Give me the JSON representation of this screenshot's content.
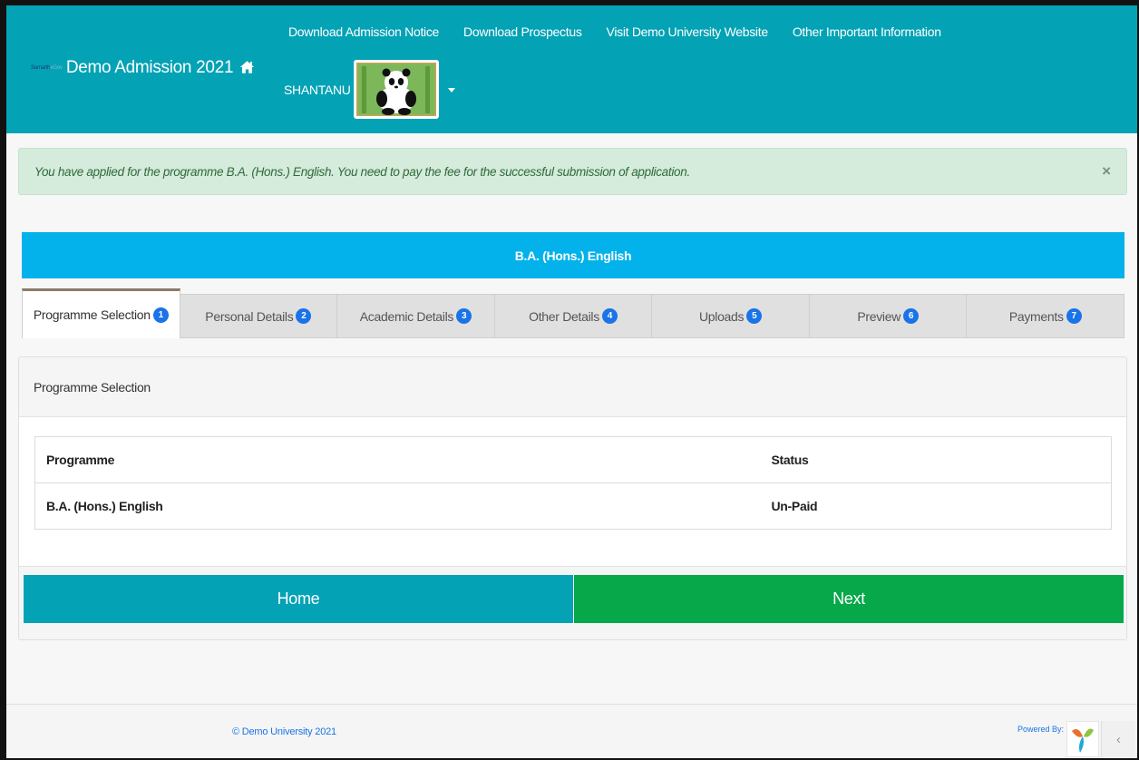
{
  "header": {
    "brand_small_1": "Samarth",
    "brand_small_2": "eGov",
    "title": "Demo Admission 2021",
    "nav_links": [
      "Download Admission Notice",
      "Download Prospectus",
      "Visit Demo University Website",
      "Other Important Information"
    ],
    "user_name": "SHANTANU"
  },
  "alert": {
    "message": "You have applied for the programme B.A. (Hons.) English. You need to pay the fee for the successful submission of application.",
    "close_glyph": "×"
  },
  "banner": {
    "programme": "B.A. (Hons.) English"
  },
  "tabs": [
    {
      "label": "Programme Selection",
      "num": "1"
    },
    {
      "label": "Personal Details",
      "num": "2"
    },
    {
      "label": "Academic Details",
      "num": "3"
    },
    {
      "label": "Other Details",
      "num": "4"
    },
    {
      "label": "Uploads",
      "num": "5"
    },
    {
      "label": "Preview",
      "num": "6"
    },
    {
      "label": "Payments",
      "num": "7"
    }
  ],
  "panel": {
    "heading": "Programme Selection",
    "table": {
      "headers": [
        "Programme",
        "Status"
      ],
      "rows": [
        [
          "B.A. (Hons.) English",
          "Un-Paid"
        ]
      ]
    }
  },
  "buttons": {
    "home": "Home",
    "next": "Next"
  },
  "footer": {
    "copyright": "© Demo University 2021",
    "powered_by": "Powered By:",
    "back_glyph": "‹"
  },
  "colors": {
    "header_bg": "#03a2b5",
    "banner_bg": "#03b2ea",
    "next_bg": "#07a84a",
    "alert_bg": "#d5ebdc",
    "badge_bg": "#1a73e8"
  }
}
